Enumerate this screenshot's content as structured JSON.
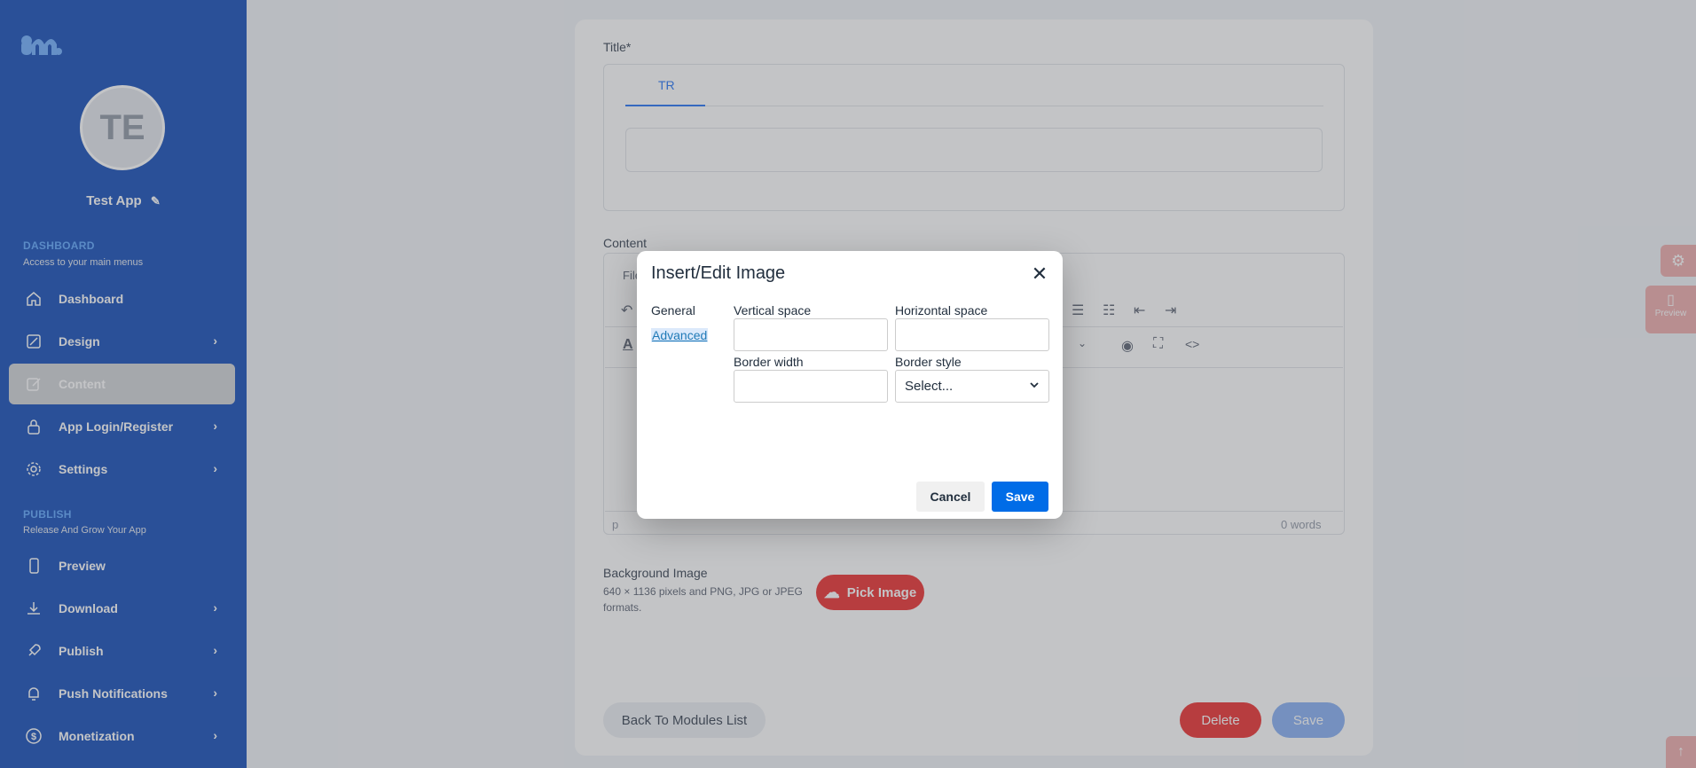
{
  "sidebar": {
    "app_initials": "TE",
    "app_name": "Test App",
    "sections": [
      {
        "title": "DASHBOARD",
        "subtitle": "Access to your main menus"
      },
      {
        "title": "PUBLISH",
        "subtitle": "Release And Grow Your App"
      }
    ],
    "items": [
      {
        "label": "Dashboard",
        "icon": "home-icon"
      },
      {
        "label": "Design",
        "icon": "design-icon"
      },
      {
        "label": "Content",
        "icon": "edit-icon"
      },
      {
        "label": "App Login/Register",
        "icon": "lock-icon"
      },
      {
        "label": "Settings",
        "icon": "gear-icon"
      },
      {
        "label": "Preview",
        "icon": "phone-icon"
      },
      {
        "label": "Download",
        "icon": "download-icon"
      },
      {
        "label": "Publish",
        "icon": "rocket-icon"
      },
      {
        "label": "Push Notifications",
        "icon": "bell-icon"
      },
      {
        "label": "Monetization",
        "icon": "dollar-icon"
      }
    ]
  },
  "main": {
    "title_label": "Title*",
    "tab_tr": "TR",
    "content_label": "Content",
    "editor_menu_fragment": "File",
    "editor_status_path": "p",
    "editor_word_count": "0 words",
    "bg_image_label": "Background Image",
    "bg_image_hint": "640 × 1136 pixels and PNG, JPG or JPEG formats.",
    "pick_image": "Pick Image",
    "back_button": "Back To Modules List",
    "delete_button": "Delete",
    "save_button": "Save"
  },
  "floating": {
    "preview_label": "Preview"
  },
  "dialog": {
    "title": "Insert/Edit Image",
    "tabs": [
      "General",
      "Advanced"
    ],
    "vertical_space_label": "Vertical space",
    "horizontal_space_label": "Horizontal space",
    "border_width_label": "Border width",
    "border_style_label": "Border style",
    "border_style_value": "Select...",
    "cancel": "Cancel",
    "save": "Save"
  },
  "colors": {
    "primary": "#006ce7",
    "sidebar_accent": "#6fb0ff",
    "danger_soft": "#f0b5b5"
  }
}
